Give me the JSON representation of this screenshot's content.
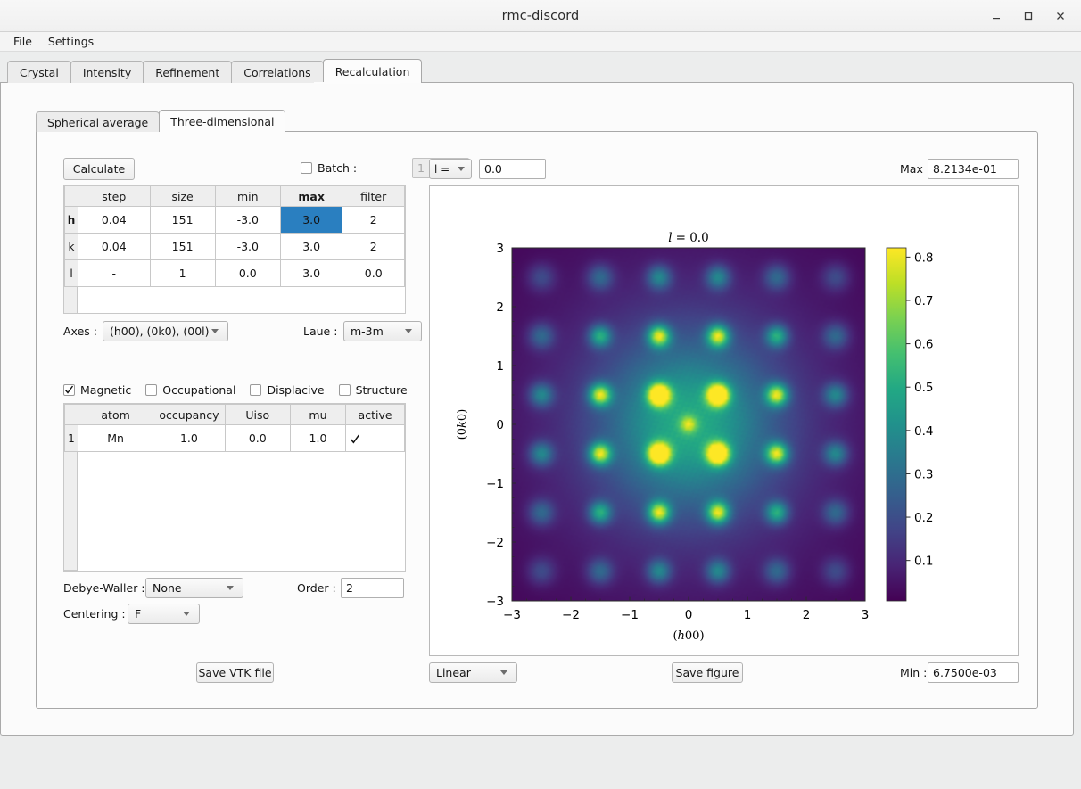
{
  "window": {
    "title": "rmc-discord",
    "minimize_label": "minimize-icon",
    "maximize_label": "maximize-icon",
    "close_label": "close-icon"
  },
  "menubar": {
    "items": [
      "File",
      "Settings"
    ]
  },
  "tabs": {
    "items": [
      "Crystal",
      "Intensity",
      "Refinement",
      "Correlations",
      "Recalculation"
    ],
    "active": "Recalculation"
  },
  "inner_tabs": {
    "items": [
      "Spherical average",
      "Three-dimensional"
    ],
    "active": "Three-dimensional"
  },
  "left_panel": {
    "calculate_button": "Calculate",
    "batch": {
      "label": "Batch :",
      "checked": false,
      "value": "1",
      "enabled": false
    },
    "hkl_table": {
      "columns": [
        "step",
        "size",
        "min",
        "max",
        "filter"
      ],
      "bold_column": "max",
      "rows": [
        {
          "header": "h",
          "step": "0.04",
          "size": "151",
          "min": "-3.0",
          "max": "3.0",
          "filter": "2",
          "selected_cell": "max"
        },
        {
          "header": "k",
          "step": "0.04",
          "size": "151",
          "min": "-3.0",
          "max": "3.0",
          "filter": "2"
        },
        {
          "header": "l",
          "step": "-",
          "size": "1",
          "min": "0.0",
          "max": "3.0",
          "filter": "0.0"
        }
      ]
    },
    "axes": {
      "label": "Axes :",
      "value": "(h00), (0k0), (00l)"
    },
    "laue": {
      "label": "Laue :",
      "value": "m-3m"
    },
    "modes": [
      {
        "label": "Magnetic",
        "checked": true
      },
      {
        "label": "Occupational",
        "checked": false
      },
      {
        "label": "Displacive",
        "checked": false
      },
      {
        "label": "Structure",
        "checked": false
      }
    ],
    "atom_table": {
      "columns": [
        "atom",
        "occupancy",
        "Uiso",
        "mu",
        "active"
      ],
      "rows": [
        {
          "header": "1",
          "atom": "Mn",
          "occupancy": "1.0",
          "Uiso": "0.0",
          "mu": "1.0",
          "active": true
        }
      ]
    },
    "debye_waller": {
      "label": "Debye-Waller :",
      "value": "None"
    },
    "order": {
      "label": "Order :",
      "value": "2"
    },
    "centering": {
      "label": "Centering :",
      "value": "F"
    },
    "save_vtk_button": "Save VTK file"
  },
  "right_panel": {
    "slice_axis": {
      "value": "l ="
    },
    "slice_value": "0.0",
    "max": {
      "label": "Max :",
      "value": "8.2134e-01"
    },
    "min": {
      "label": "Min :",
      "value": "6.7500e-03"
    },
    "scale": {
      "value": "Linear"
    },
    "save_figure_button": "Save figure"
  },
  "chart_data": {
    "type": "heatmap",
    "title": "l = 0.0",
    "title_symbol": "l",
    "title_value": "0.0",
    "xlabel": "(h00)",
    "ylabel": "(0k0)",
    "xlabel_italic": "h",
    "ylabel_italic": "k",
    "xlim": [
      -3,
      3
    ],
    "ylim": [
      -3,
      3
    ],
    "xticks": [
      -3,
      -2,
      -1,
      0,
      1,
      2,
      3
    ],
    "yticks": [
      -3,
      -2,
      -1,
      0,
      1,
      2,
      3
    ],
    "xticklabels": [
      "−3",
      "−2",
      "−1",
      "0",
      "1",
      "2",
      "3"
    ],
    "yticklabels": [
      "−3",
      "−2",
      "−1",
      "0",
      "1",
      "2",
      "3"
    ],
    "minor_tick_step": 0.25,
    "grid": false,
    "colormap": "viridis",
    "colormap_stops": [
      "#440154",
      "#482475",
      "#414487",
      "#355f8d",
      "#2a788e",
      "#21918c",
      "#22a884",
      "#44bf70",
      "#7ad151",
      "#bddf26",
      "#fde725"
    ],
    "colorbar": {
      "vmin": 0.00675,
      "vmax": 0.82134,
      "ticks": [
        0.1,
        0.2,
        0.3,
        0.4,
        0.5,
        0.6,
        0.7,
        0.8
      ],
      "ticklabels": [
        "0.1",
        "0.2",
        "0.3",
        "0.4",
        "0.5",
        "0.6",
        "0.7",
        "0.8"
      ],
      "position": "right"
    },
    "description": "Magnetic diffuse scattering slice; Gaussian peaks on a half-integer (h,k) grid, brightest at (±0.5,±0.5).",
    "peaks": [
      {
        "x": -0.5,
        "y": 0.5,
        "amp": 0.82,
        "sigma": 0.13
      },
      {
        "x": 0.5,
        "y": 0.5,
        "amp": 0.82,
        "sigma": 0.13
      },
      {
        "x": -0.5,
        "y": -0.5,
        "amp": 0.82,
        "sigma": 0.13
      },
      {
        "x": 0.5,
        "y": -0.5,
        "amp": 0.82,
        "sigma": 0.13
      },
      {
        "x": -1.5,
        "y": 0.5,
        "amp": 0.6,
        "sigma": 0.13
      },
      {
        "x": 1.5,
        "y": 0.5,
        "amp": 0.6,
        "sigma": 0.13
      },
      {
        "x": -1.5,
        "y": -0.5,
        "amp": 0.6,
        "sigma": 0.13
      },
      {
        "x": 1.5,
        "y": -0.5,
        "amp": 0.6,
        "sigma": 0.13
      },
      {
        "x": -0.5,
        "y": 1.5,
        "amp": 0.6,
        "sigma": 0.13
      },
      {
        "x": 0.5,
        "y": 1.5,
        "amp": 0.6,
        "sigma": 0.13
      },
      {
        "x": -0.5,
        "y": -1.5,
        "amp": 0.6,
        "sigma": 0.13
      },
      {
        "x": 0.5,
        "y": -1.5,
        "amp": 0.6,
        "sigma": 0.13
      },
      {
        "x": -1.5,
        "y": 1.5,
        "amp": 0.4,
        "sigma": 0.13
      },
      {
        "x": 1.5,
        "y": 1.5,
        "amp": 0.4,
        "sigma": 0.13
      },
      {
        "x": -1.5,
        "y": -1.5,
        "amp": 0.4,
        "sigma": 0.13
      },
      {
        "x": 1.5,
        "y": -1.5,
        "amp": 0.4,
        "sigma": 0.13
      },
      {
        "x": -2.5,
        "y": 0.5,
        "amp": 0.3,
        "sigma": 0.14
      },
      {
        "x": 2.5,
        "y": 0.5,
        "amp": 0.3,
        "sigma": 0.14
      },
      {
        "x": -2.5,
        "y": -0.5,
        "amp": 0.3,
        "sigma": 0.14
      },
      {
        "x": 2.5,
        "y": -0.5,
        "amp": 0.3,
        "sigma": 0.14
      },
      {
        "x": -0.5,
        "y": 2.5,
        "amp": 0.3,
        "sigma": 0.14
      },
      {
        "x": 0.5,
        "y": 2.5,
        "amp": 0.3,
        "sigma": 0.14
      },
      {
        "x": -0.5,
        "y": -2.5,
        "amp": 0.3,
        "sigma": 0.14
      },
      {
        "x": 0.5,
        "y": -2.5,
        "amp": 0.3,
        "sigma": 0.14
      },
      {
        "x": -2.5,
        "y": 1.5,
        "amp": 0.22,
        "sigma": 0.15
      },
      {
        "x": 2.5,
        "y": 1.5,
        "amp": 0.22,
        "sigma": 0.15
      },
      {
        "x": -2.5,
        "y": -1.5,
        "amp": 0.22,
        "sigma": 0.15
      },
      {
        "x": 2.5,
        "y": -1.5,
        "amp": 0.22,
        "sigma": 0.15
      },
      {
        "x": -1.5,
        "y": 2.5,
        "amp": 0.22,
        "sigma": 0.15
      },
      {
        "x": 1.5,
        "y": 2.5,
        "amp": 0.22,
        "sigma": 0.15
      },
      {
        "x": -1.5,
        "y": -2.5,
        "amp": 0.22,
        "sigma": 0.15
      },
      {
        "x": 1.5,
        "y": -2.5,
        "amp": 0.22,
        "sigma": 0.15
      },
      {
        "x": -2.5,
        "y": 2.5,
        "amp": 0.15,
        "sigma": 0.16
      },
      {
        "x": 2.5,
        "y": 2.5,
        "amp": 0.15,
        "sigma": 0.16
      },
      {
        "x": -2.5,
        "y": -2.5,
        "amp": 0.15,
        "sigma": 0.16
      },
      {
        "x": 2.5,
        "y": -2.5,
        "amp": 0.15,
        "sigma": 0.16
      },
      {
        "x": 0,
        "y": 0,
        "amp": 0.3,
        "sigma": 0.1
      },
      {
        "x": 0,
        "y": 0,
        "amp": 0.34,
        "sigma": 0.95
      },
      {
        "x": 0,
        "y": 0,
        "amp": 0.16,
        "sigma": 1.9
      }
    ]
  }
}
